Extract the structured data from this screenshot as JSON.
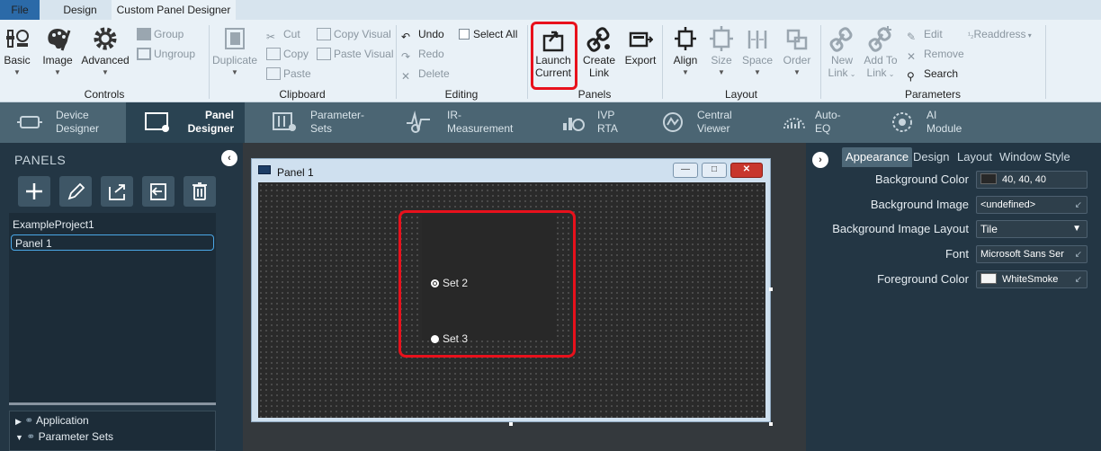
{
  "tabs": {
    "file": "File",
    "design": "Design",
    "custom_panel_designer": "Custom Panel Designer"
  },
  "ribbon": {
    "controls": {
      "basic": "Basic",
      "image": "Image",
      "advanced": "Advanced",
      "group": "Group",
      "ungroup": "Ungroup",
      "label": "Controls"
    },
    "clipboard": {
      "duplicate": "Duplicate",
      "cut": "Cut",
      "copy": "Copy",
      "paste": "Paste",
      "copy_visual": "Copy Visual",
      "paste_visual": "Paste Visual",
      "label": "Clipboard"
    },
    "editing": {
      "undo": "Undo",
      "redo": "Redo",
      "delete": "Delete",
      "select_all": "Select All",
      "label": "Editing"
    },
    "panels": {
      "launch_line1": "Launch",
      "launch_line2": "Current",
      "create_line1": "Create",
      "create_line2": "Link",
      "export": "Export",
      "label": "Panels"
    },
    "layout": {
      "align": "Align",
      "size": "Size",
      "space": "Space",
      "order": "Order",
      "label": "Layout"
    },
    "parameters": {
      "new_line1": "New",
      "new_line2": "Link",
      "addto_line1": "Add To",
      "addto_line2": "Link",
      "edit": "Edit",
      "remove": "Remove",
      "search": "Search",
      "readdress": "Readdress",
      "label": "Parameters"
    }
  },
  "modules": [
    {
      "line1": "Device",
      "line2": "Designer"
    },
    {
      "line1": "Panel",
      "line2": "Designer"
    },
    {
      "line1": "Parameter-",
      "line2": "Sets"
    },
    {
      "line1": "IR-",
      "line2": "Measurement"
    },
    {
      "line1": "IVP",
      "line2": "RTA"
    },
    {
      "line1": "Central",
      "line2": "Viewer"
    },
    {
      "line1": "Auto-",
      "line2": "EQ"
    },
    {
      "line1": "AI",
      "line2": "Module"
    }
  ],
  "left_panel": {
    "title": "PANELS",
    "collapse": "‹",
    "tree": {
      "project": "ExampleProject1",
      "panel": "Panel 1"
    },
    "bottom_tree": {
      "application": "Application",
      "parameter_sets": "Parameter Sets"
    }
  },
  "panel_window": {
    "title": "Panel 1",
    "controls": {
      "minimize": "—",
      "maximize": "□",
      "close": "✕"
    },
    "radios": [
      {
        "label": "Set 2",
        "checked": true
      },
      {
        "label": "Set 3",
        "checked": false
      }
    ]
  },
  "right_panel": {
    "collapse": "›",
    "tabs": [
      "Appearance",
      "Design",
      "Layout",
      "Window Style"
    ],
    "properties": [
      {
        "label": "Background Color",
        "value": "40, 40, 40",
        "swatch": "#282828"
      },
      {
        "label": "Background Image",
        "value": "<undefined>"
      },
      {
        "label": "Background Image Layout",
        "value": "Tile"
      },
      {
        "label": "Font",
        "value": "Microsoft Sans Ser"
      },
      {
        "label": "Foreground Color",
        "value": "WhiteSmoke",
        "swatch": "#f5f5f5"
      }
    ]
  },
  "colors": {
    "accent_blue": "#2b6aa8",
    "highlight_red": "#e8111c",
    "ribbon_bg": "#e9f1f7",
    "nav_bg": "#4b6573",
    "panel_bg": "#233644"
  },
  "icons": {
    "basic": "basic-controls-icon",
    "image": "palette-icon",
    "advanced": "gear-icon",
    "duplicate": "duplicate-icon",
    "launch": "launch-icon",
    "create_link": "link-icon",
    "export": "export-icon",
    "align": "align-icon",
    "size": "size-icon",
    "space": "space-icon",
    "order": "order-icon",
    "new_link": "new-link-icon",
    "add_to_link": "add-link-icon"
  }
}
